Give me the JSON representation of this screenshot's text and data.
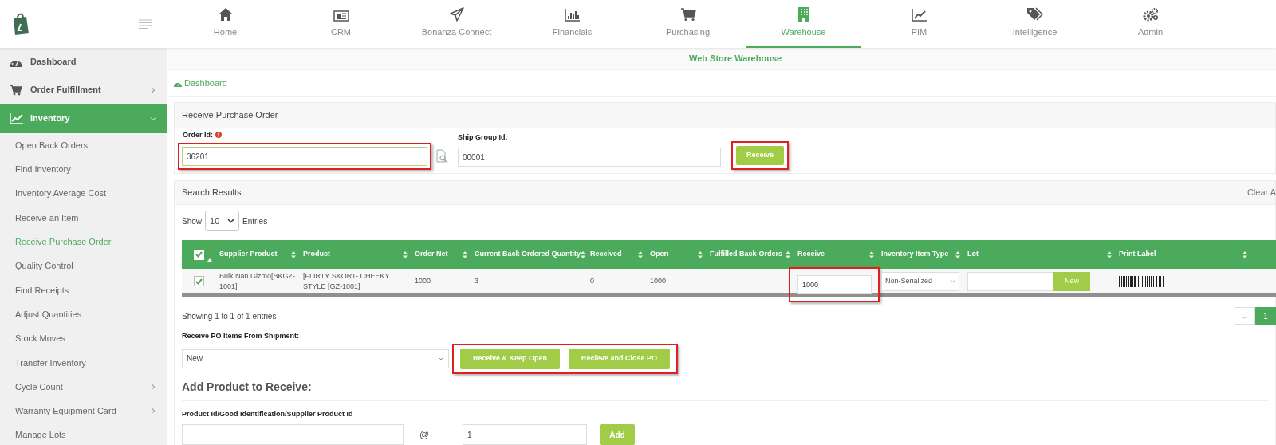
{
  "header": {
    "nav": [
      {
        "label": "Home",
        "selected": false
      },
      {
        "label": "CRM",
        "selected": false
      },
      {
        "label": "Bonanza Connect",
        "selected": false
      },
      {
        "label": "Financials",
        "selected": false
      },
      {
        "label": "Purchasing",
        "selected": false
      },
      {
        "label": "Warehouse",
        "selected": true
      },
      {
        "label": "PIM",
        "selected": false
      },
      {
        "label": "Intelligence",
        "selected": false
      },
      {
        "label": "Admin",
        "selected": false
      }
    ],
    "context": "Web Store Warehouse"
  },
  "breadcrumb": "Dashboard",
  "sidebar": {
    "items": [
      {
        "label": "Dashboard",
        "selected": false
      },
      {
        "label": "Order Fulfillment",
        "selected": false,
        "expanded": false
      },
      {
        "label": "Inventory",
        "selected": true,
        "expanded": true,
        "children": [
          {
            "label": "Open Back Orders",
            "selected": false
          },
          {
            "label": "Find Inventory",
            "selected": false
          },
          {
            "label": "Inventory Average Cost",
            "selected": false
          },
          {
            "label": "Receive an Item",
            "selected": false
          },
          {
            "label": "Receive Purchase Order",
            "selected": true
          },
          {
            "label": "Quality Control",
            "selected": false
          },
          {
            "label": "Find Receipts",
            "selected": false
          },
          {
            "label": "Adjust Quantities",
            "selected": false
          },
          {
            "label": "Stock Moves",
            "selected": false
          },
          {
            "label": "Transfer Inventory",
            "selected": false
          },
          {
            "label": "Cycle Count",
            "selected": false,
            "expanded": false
          },
          {
            "label": "Warranty Equipment Card",
            "selected": false,
            "expanded": false
          },
          {
            "label": "Manage Lots",
            "selected": false
          }
        ]
      }
    ]
  },
  "receive_panel": {
    "title": "Receive Purchase Order",
    "order_id": {
      "label": "Order Id:",
      "value": "36201",
      "required": true,
      "highlighted": true
    },
    "ship_group_id": {
      "label": "Ship Group Id:",
      "value": "00001"
    },
    "receive_button": {
      "label": "Receive",
      "highlighted": true
    }
  },
  "results": {
    "title": "Search Results",
    "clear": "Clear A",
    "show": "Show",
    "page_size": "10",
    "entries": "Entries",
    "table": {
      "all_selected": true,
      "columns": [
        "Supplier Product",
        "Product",
        "Order Net",
        "Current Back Ordered Quantity",
        "Received",
        "Open",
        "Fulfilled Back-Orders",
        "Receive",
        "Inventory Item Type",
        "Lot",
        "Print Label"
      ],
      "rows": [
        {
          "checked": true,
          "supplier_product": "Bulk Nan Gizmo[BKGZ-1001]",
          "product": "[FLIRTY SKORT- CHEEKY STYLE  [GZ-1001]",
          "order_net": "1000",
          "back_ordered": "3",
          "received": "0",
          "open": "1000",
          "receive": "1000",
          "receive_highlighted": true,
          "item_type": "Non-Serialized",
          "lot_button": "New"
        }
      ]
    },
    "info": "Showing 1 to 1 of 1 entries",
    "pagination": [
      {
        "label": "←",
        "selected": false
      },
      {
        "label": "1",
        "selected": true
      }
    ]
  },
  "shipment": {
    "label": "Receive PO Items From Shipment:",
    "value": "New"
  },
  "actions": {
    "highlighted": true,
    "buttons": [
      "Receive & Keep Open",
      "Recieve and Close PO"
    ]
  },
  "add_product": {
    "title": "Add Product to Receive:",
    "label": "Product Id/Good Identification/Supplier Product Id",
    "at": "@",
    "quantity": "1",
    "button": "Add"
  }
}
